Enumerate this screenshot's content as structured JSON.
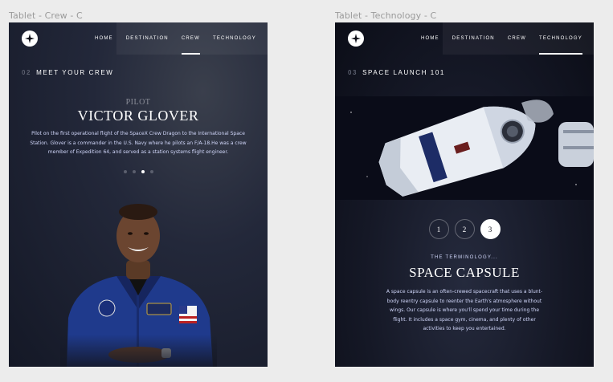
{
  "frames": {
    "crew_label": "Tablet - Crew - C",
    "tech_label": "Tablet - Technology - C"
  },
  "nav": {
    "home": "HOME",
    "destination": "DESTINATION",
    "crew": "CREW",
    "technology": "TECHNOLOGY"
  },
  "crew": {
    "section_num": "02",
    "section_title": "MEET YOUR CREW",
    "role": "PILOT",
    "name": "VICTOR GLOVER",
    "bio": "Pilot on the first operational flight of the SpaceX Crew Dragon to the International Space Station. Glover is a commander in the U.S. Navy where he pilots an F/A-18.He was a crew member of Expedition 64, and served as a station systems flight engineer.",
    "active_dot": 3,
    "dot_count": 4
  },
  "technology": {
    "section_num": "03",
    "section_title": "SPACE LAUNCH 101",
    "steps": [
      "1",
      "2",
      "3"
    ],
    "active_step": 3,
    "term_label": "THE TERMINOLOGY...",
    "term_name": "SPACE CAPSULE",
    "description": "A space capsule is an often-crewed spacecraft that uses a blunt-body reentry capsule to reenter the Earth's atmosphere without wings. Our capsule is where you'll spend your time during the flight. It includes a space gym, cinema, and plenty of other activities to keep you entertained."
  },
  "colors": {
    "accent": "#ffffff",
    "muted": "#5b5f6e",
    "text_light": "#d0d6f9",
    "bg_dark": "#0b0d17"
  },
  "icons": {
    "logo": "star-logo-icon"
  }
}
